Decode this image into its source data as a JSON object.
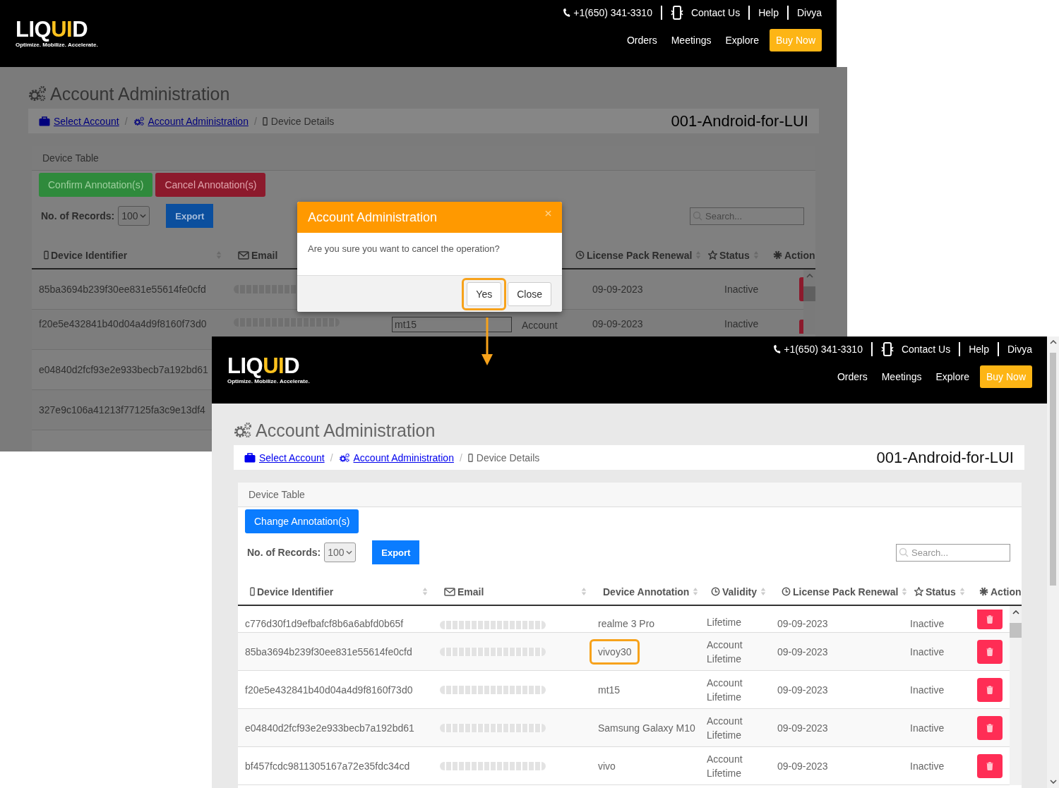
{
  "screenshots": [
    {
      "kind": "before",
      "header": {
        "logo": {
          "parts": [
            {
              "text": "LIQ",
              "accent": false
            },
            {
              "text": "UI",
              "accent": true
            },
            {
              "text": "D",
              "accent": false
            }
          ],
          "tagline": "Optimize. Mobilize. Accelerate."
        },
        "top_links": [
          {
            "label": "+1(650) 341-3310",
            "kind": "phone"
          },
          {
            "label": "Contact Us",
            "kind": "contact"
          },
          {
            "label": "Help",
            "kind": "text"
          },
          {
            "label": "Divya",
            "kind": "text"
          }
        ],
        "nav": [
          "Orders",
          "Meetings",
          "Explore"
        ],
        "cta": "Buy Now"
      },
      "page_title": "Account Administration",
      "breadcrumb": {
        "separator": "/",
        "items": [
          {
            "label": "Select Account",
            "link": true
          },
          {
            "label": "Account Administration",
            "link": true
          },
          {
            "label": "Device Details",
            "link": false
          }
        ],
        "account": "001-Android-for-LUI"
      },
      "card_title": "Device Table",
      "actions": [
        {
          "label": "Confirm Annotation(s)",
          "kind": "confirm"
        },
        {
          "label": "Cancel Annotation(s)",
          "kind": "cancel"
        }
      ],
      "records": {
        "label": "No. of Records:",
        "value": "100"
      },
      "export": "Export",
      "search": {
        "placeholder": "Search..."
      },
      "columns": [
        {
          "kind": "device_id",
          "label": "Device Identifier",
          "sortable": true
        },
        {
          "kind": "email",
          "label": "Email",
          "sortable": false
        },
        {
          "kind": "renewal",
          "label": "License Pack Renewal",
          "sortable": true
        },
        {
          "kind": "status",
          "label": "Status",
          "sortable": true
        },
        {
          "kind": "action",
          "label": "Action",
          "sortable": false
        }
      ],
      "rows": [
        {
          "device_id": "85ba3694b239f30ee831e55614fe0cfd",
          "email_blurred": true,
          "renewal": "09-09-2023",
          "status": "Inactive",
          "delete_button": true
        },
        {
          "device_id": "f20e5e432841b40d04a4d9f8160f73d0",
          "email_blurred": true,
          "annotation": "mt15",
          "editing": true,
          "validity": "Account",
          "renewal": "09-09-2023",
          "status": "Inactive",
          "delete_button": true
        },
        {
          "device_id": "e04840d2fcf93e2e933becb7a192bd61",
          "email_blurred": false,
          "delete_button": false
        },
        {
          "device_id": "327e9c106a41213f77125fa3c9e13df4",
          "email_blurred": false,
          "delete_button": false
        }
      ],
      "modal": {
        "title": "Account Administration",
        "message": "Are you sure you want to cancel the operation?",
        "buttons": [
          {
            "label": "Yes",
            "highlighted": true
          },
          {
            "label": "Close",
            "highlighted": false
          }
        ]
      }
    },
    {
      "kind": "after",
      "header": {
        "logo": {
          "parts": [
            {
              "text": "LIQ",
              "accent": false
            },
            {
              "text": "UI",
              "accent": true
            },
            {
              "text": "D",
              "accent": false
            }
          ],
          "tagline": "Optimize. Mobilize. Accelerate."
        },
        "top_links": [
          {
            "label": "+1(650) 341-3310",
            "kind": "phone"
          },
          {
            "label": "Contact Us",
            "kind": "contact"
          },
          {
            "label": "Help",
            "kind": "text"
          },
          {
            "label": "Divya",
            "kind": "text"
          }
        ],
        "nav": [
          "Orders",
          "Meetings",
          "Explore"
        ],
        "cta": "Buy Now"
      },
      "page_title": "Account Administration",
      "breadcrumb": {
        "separator": "/",
        "items": [
          {
            "label": "Select Account",
            "link": true
          },
          {
            "label": "Account Administration",
            "link": true
          },
          {
            "label": "Device Details",
            "link": false
          }
        ],
        "account": "001-Android-for-LUI"
      },
      "card_title": "Device Table",
      "actions": [
        {
          "label": "Change Annotation(s)",
          "kind": "change"
        }
      ],
      "records": {
        "label": "No. of Records:",
        "value": "100"
      },
      "export": "Export",
      "search": {
        "placeholder": "Search..."
      },
      "columns": [
        {
          "kind": "device_id",
          "label": "Device Identifier",
          "sortable": true
        },
        {
          "kind": "email",
          "label": "Email",
          "sortable": true
        },
        {
          "kind": "annotation",
          "label": "Device Annotation",
          "sortable": true
        },
        {
          "kind": "validity",
          "label": "Validity",
          "sortable": true
        },
        {
          "kind": "renewal",
          "label": "License Pack Renewal",
          "sortable": true
        },
        {
          "kind": "status",
          "label": "Status",
          "sortable": true
        },
        {
          "kind": "action",
          "label": "Action",
          "sortable": false
        }
      ],
      "rows": [
        {
          "device_id": "c776d30f1d9efbafcf8b6a6abfd0b65f",
          "email_blurred": true,
          "annotation": "realme 3 Pro",
          "editing": false,
          "highlighted": false,
          "validity": "Lifetime",
          "renewal": "09-09-2023",
          "status": "Inactive",
          "delete_button": true
        },
        {
          "device_id": "85ba3694b239f30ee831e55614fe0cfd",
          "email_blurred": true,
          "annotation": "vivoy30",
          "editing": false,
          "highlighted": true,
          "validity": "Account Lifetime",
          "renewal": "09-09-2023",
          "status": "Inactive",
          "delete_button": true
        },
        {
          "device_id": "f20e5e432841b40d04a4d9f8160f73d0",
          "email_blurred": true,
          "annotation": "mt15",
          "editing": false,
          "highlighted": false,
          "validity": "Account Lifetime",
          "renewal": "09-09-2023",
          "status": "Inactive",
          "delete_button": true
        },
        {
          "device_id": "e04840d2fcf93e2e933becb7a192bd61",
          "email_blurred": true,
          "annotation": "Samsung Galaxy M10",
          "editing": false,
          "highlighted": false,
          "validity": "Account Lifetime",
          "renewal": "09-09-2023",
          "status": "Inactive",
          "delete_button": true
        },
        {
          "device_id": "bf457fcdc9811305167a72e35fdc34cd",
          "email_blurred": true,
          "annotation": "vivo",
          "editing": false,
          "highlighted": false,
          "validity": "Account Lifetime",
          "renewal": "09-09-2023",
          "status": "Inactive",
          "delete_button": true
        }
      ]
    }
  ]
}
